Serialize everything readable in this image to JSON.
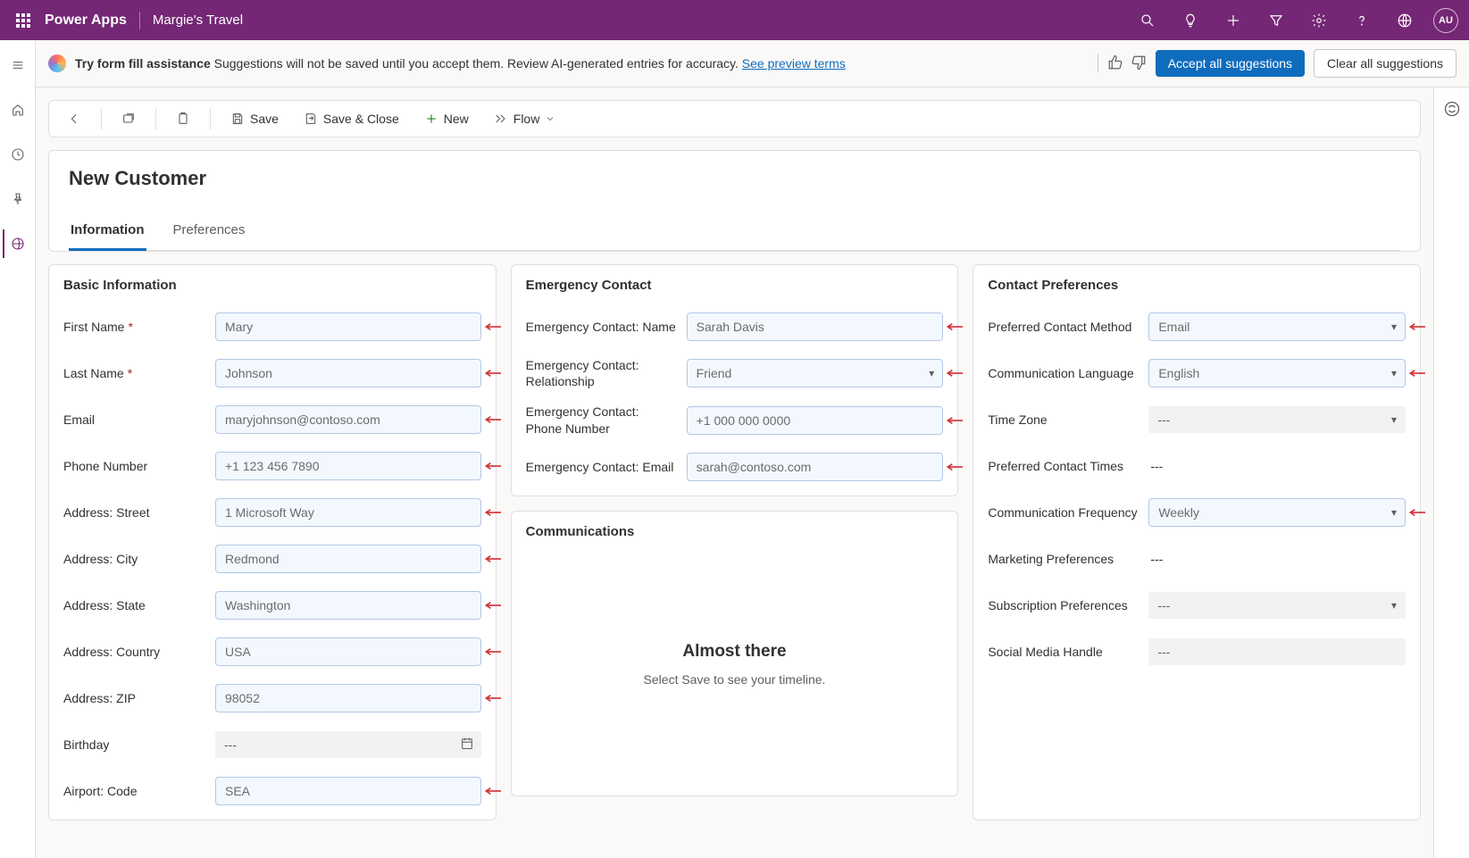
{
  "header": {
    "app_name": "Power Apps",
    "env_name": "Margie's Travel",
    "avatar_initials": "AU"
  },
  "banner": {
    "bold": "Try form fill assistance",
    "text": " Suggestions will not be saved until you accept them. Review AI-generated entries for accuracy. ",
    "link": "See preview terms",
    "accept_btn": "Accept all suggestions",
    "clear_btn": "Clear all suggestions"
  },
  "commands": {
    "save": "Save",
    "save_close": "Save & Close",
    "new": "New",
    "flow": "Flow"
  },
  "record": {
    "title": "New Customer",
    "tabs": {
      "information": "Information",
      "preferences": "Preferences"
    }
  },
  "sections": {
    "basic": {
      "title": "Basic Information",
      "fields": {
        "first_name": {
          "label": "First Name",
          "value": "Mary"
        },
        "last_name": {
          "label": "Last Name",
          "value": "Johnson"
        },
        "email": {
          "label": "Email",
          "value": "maryjohnson@contoso.com"
        },
        "phone": {
          "label": "Phone Number",
          "value": "+1 123 456 7890"
        },
        "street": {
          "label": "Address: Street",
          "value": "1 Microsoft Way"
        },
        "city": {
          "label": "Address: City",
          "value": "Redmond"
        },
        "state": {
          "label": "Address: State",
          "value": "Washington"
        },
        "country": {
          "label": "Address: Country",
          "value": "USA"
        },
        "zip": {
          "label": "Address: ZIP",
          "value": "98052"
        },
        "birthday": {
          "label": "Birthday",
          "value": "---"
        },
        "airport": {
          "label": "Airport: Code",
          "value": "SEA"
        }
      }
    },
    "emergency": {
      "title": "Emergency Contact",
      "fields": {
        "name": {
          "label": "Emergency Contact: Name",
          "value": "Sarah Davis"
        },
        "relationship": {
          "label": "Emergency Contact: Relationship",
          "value": "Friend"
        },
        "phone": {
          "label": "Emergency Contact: Phone Number",
          "value": "+1 000 000 0000"
        },
        "email": {
          "label": "Emergency Contact: Email",
          "value": "sarah@contoso.com"
        }
      }
    },
    "communications": {
      "title": "Communications",
      "heading": "Almost there",
      "sub": "Select Save to see your timeline."
    },
    "prefs": {
      "title": "Contact Preferences",
      "fields": {
        "method": {
          "label": "Preferred Contact Method",
          "value": "Email"
        },
        "language": {
          "label": "Communication Language",
          "value": "English"
        },
        "timezone": {
          "label": "Time Zone",
          "value": "---"
        },
        "times": {
          "label": "Preferred Contact Times",
          "value": "---"
        },
        "frequency": {
          "label": "Communication Frequency",
          "value": "Weekly"
        },
        "marketing": {
          "label": "Marketing Preferences",
          "value": "---"
        },
        "subscription": {
          "label": "Subscription Preferences",
          "value": "---"
        },
        "social": {
          "label": "Social Media Handle",
          "value": "---"
        }
      }
    }
  }
}
